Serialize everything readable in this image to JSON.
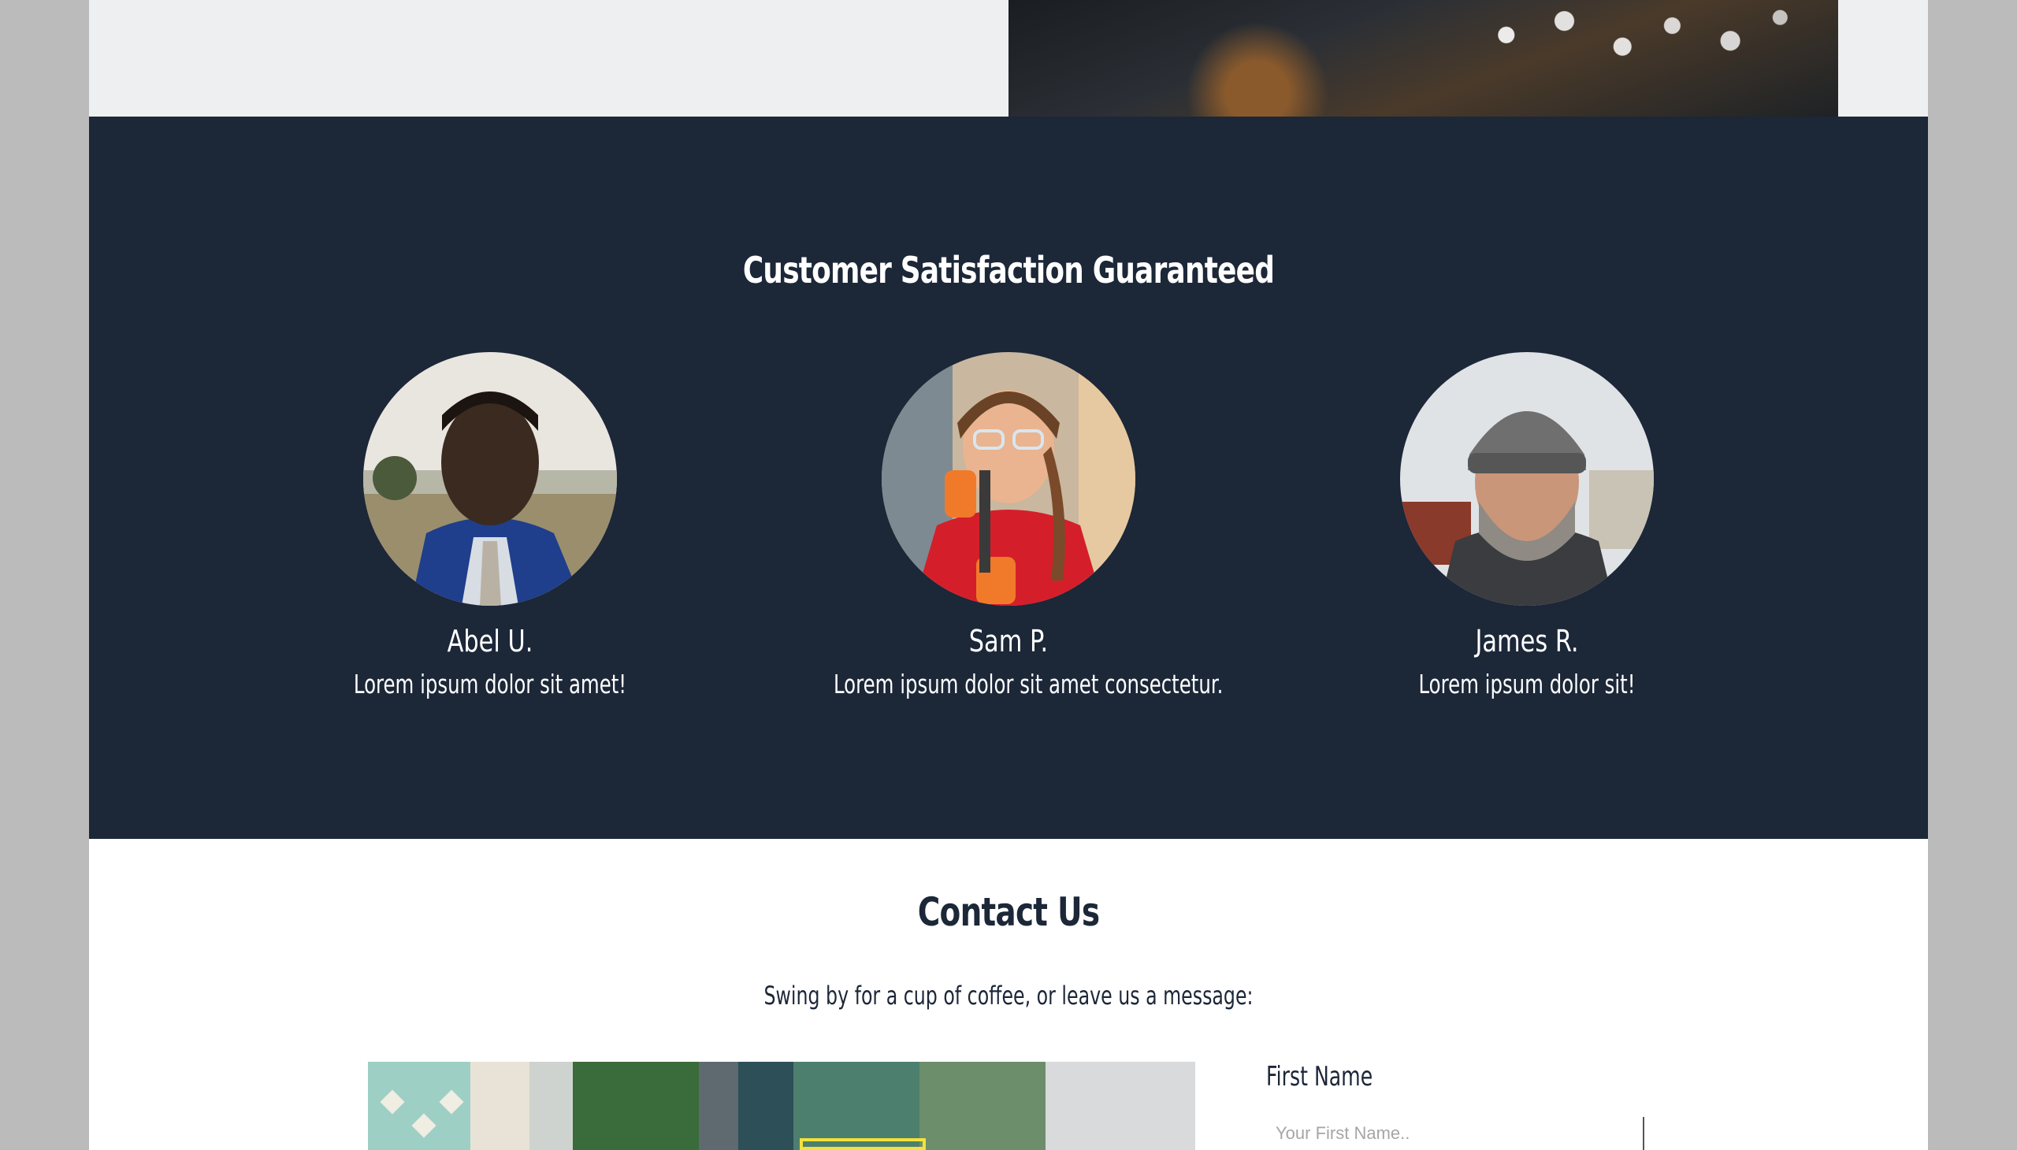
{
  "testimonials": {
    "title": "Customer Satisfaction Guaranteed",
    "people": [
      {
        "name": "Abel U.",
        "quote": "Lorem ipsum dolor sit amet!"
      },
      {
        "name": "Sam P.",
        "quote": "Lorem ipsum dolor sit amet consectetur."
      },
      {
        "name": "James R.",
        "quote": "Lorem ipsum dolor sit!"
      }
    ]
  },
  "contact": {
    "title": "Contact Us",
    "subtitle": "Swing by for a cup of coffee, or leave us a message:",
    "form": {
      "first_name_label": "First Name",
      "first_name_placeholder": "Your First Name.."
    }
  },
  "colors": {
    "navy": "#1c2738",
    "white": "#ffffff",
    "outer_gray": "#bcbbbc",
    "light_gray": "#eeeff1"
  }
}
